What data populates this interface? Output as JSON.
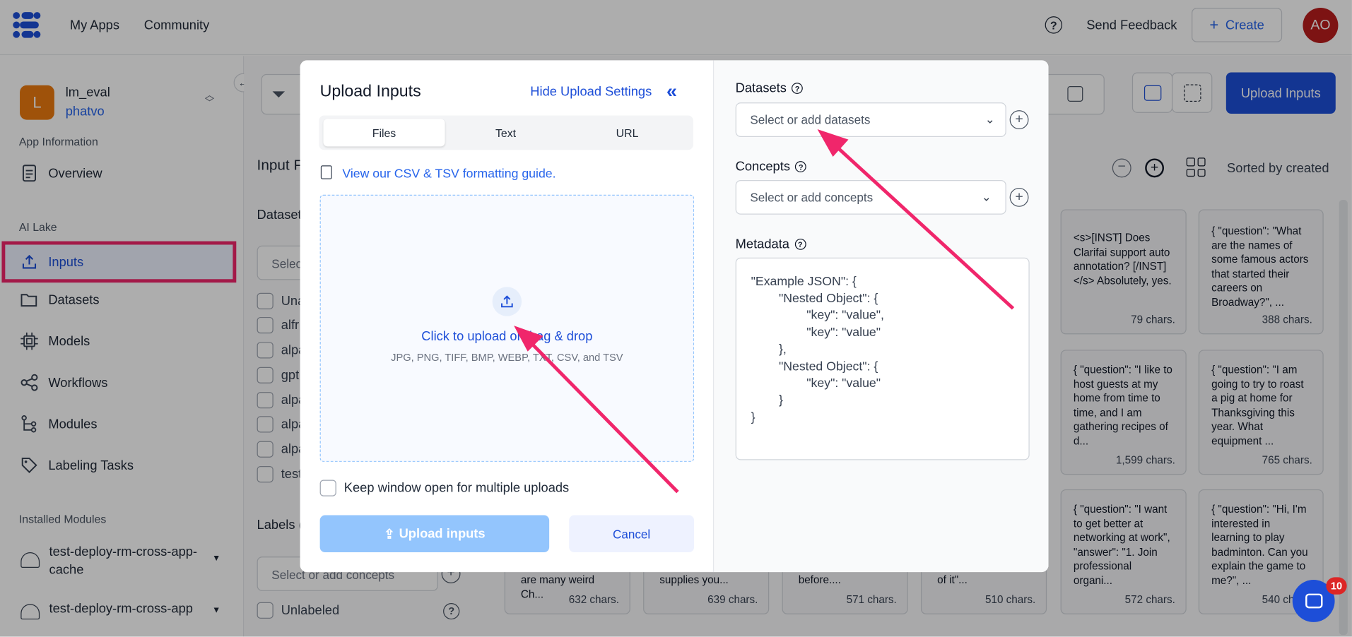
{
  "topbar": {
    "nav": [
      "My Apps",
      "Community"
    ],
    "help_icon": "help-circle-icon",
    "feedback": "Send Feedback",
    "create": "Create",
    "avatar_initials": "AO"
  },
  "app": {
    "initial": "L",
    "name": "lm_eval",
    "owner": "phatvo"
  },
  "sidebar": {
    "app_info_label": "App Information",
    "overview": "Overview",
    "ai_lake_label": "AI Lake",
    "items": [
      {
        "label": "Inputs",
        "icon": "upload-icon"
      },
      {
        "label": "Datasets",
        "icon": "folder-icon"
      },
      {
        "label": "Models",
        "icon": "chip-icon"
      },
      {
        "label": "Workflows",
        "icon": "share-nodes-icon"
      },
      {
        "label": "Modules",
        "icon": "tree-icon"
      },
      {
        "label": "Labeling Tasks",
        "icon": "tag-icon"
      }
    ],
    "installed_label": "Installed Modules",
    "modules": [
      "test-deploy-rm-cross-app-cache",
      "test-deploy-rm-cross-app"
    ]
  },
  "main": {
    "upload_button": "Upload Inputs",
    "sorted": "Sorted by created",
    "input_filters_title": "Input F",
    "datasets_title": "Dataset",
    "select_short": "Selec",
    "dataset_items": [
      "Una",
      "alfr",
      "alpa",
      "gpt",
      "alpa",
      "alpa",
      "alpa",
      "test"
    ],
    "labels_title": "Labels (",
    "concepts_placeholder": "Select or add concepts",
    "unlabeled": "Unlabeled",
    "cards": [
      {
        "text": "<s>[INST] Does Clarifai support auto annotation? [/INST] </s> Absolutely, yes.",
        "chars": "79 chars."
      },
      {
        "text": "{ \"question\": \"What are the names of some famous actors that started their careers on Broadway?\", ...",
        "chars": "388 chars."
      },
      {
        "text": "{ \"question\": \"I like to host guests at my home from time to time, and I am gathering recipes of d...",
        "chars": "1,599 chars."
      },
      {
        "text": "{ \"question\": \"I am going to try to roast a pig at home for Thanksgiving this year. What equipment ...",
        "chars": "765 chars."
      },
      {
        "text": "{ \"question\": \"I want to get better at networking at work\", \"answer\": \"1. Join professional organi...",
        "chars": "572 chars."
      },
      {
        "text": "{ \"question\": \"Hi, I'm interested in learning to play badminton. Can you explain the game to me?\", ...",
        "chars": "540 chars."
      }
    ],
    "bottom_cards": [
      {
        "text": "are many weird Ch...",
        "chars": "632 chars."
      },
      {
        "text": "supplies you...",
        "chars": "639 chars."
      },
      {
        "text": "before....",
        "chars": "571 chars."
      },
      {
        "text": "of it\"...",
        "chars": "510 chars."
      }
    ],
    "chat_badge": "10"
  },
  "modal": {
    "title": "Upload Inputs",
    "hide_settings": "Hide Upload Settings",
    "tabs": [
      "Files",
      "Text",
      "URL"
    ],
    "guide_link": "View our CSV & TSV formatting guide.",
    "dropzone_text": "Click to upload or drag & drop",
    "dropzone_formats": "JPG, PNG, TIFF, BMP, WEBP, TXT, CSV, and TSV",
    "keep_open": "Keep window open for multiple uploads",
    "upload_button": "Upload inputs",
    "cancel_button": "Cancel",
    "datasets_label": "Datasets",
    "datasets_placeholder": "Select or add datasets",
    "concepts_label": "Concepts",
    "concepts_placeholder": "Select or add concepts",
    "metadata_label": "Metadata",
    "metadata_placeholder": "\"Example JSON\": {\n        \"Nested Object\": {\n                \"key\": \"value\",\n                \"key\": \"value\"\n        },\n        \"Nested Object\": {\n                \"key\": \"value\"\n        }\n}"
  },
  "colors": {
    "brand": "#1d4ed8",
    "link": "#2563eb",
    "highlight": "#f0266b",
    "arrow": "#f0266b"
  }
}
